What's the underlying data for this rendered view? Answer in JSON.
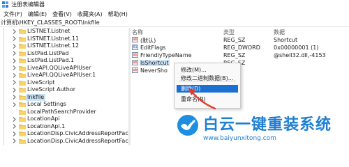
{
  "window": {
    "title": "注册表编辑器"
  },
  "menu": [
    "文件(F)",
    "编辑(E)",
    "查看(V)",
    "收藏夹(A)",
    "帮助(H)"
  ],
  "address": "计算机\\HKEY_CLASSES_ROOT\\lnkfile",
  "tree": {
    "items": [
      {
        "label": "LISTNET.Listnet",
        "expandable": true,
        "selected": false
      },
      {
        "label": "LISTNET.Listnet.11",
        "expandable": true,
        "selected": false
      },
      {
        "label": "LISTNET.Listnet.12",
        "expandable": true,
        "selected": false
      },
      {
        "label": "ListPad.ListPad",
        "expandable": true,
        "selected": false
      },
      {
        "label": "ListPad.ListPad.1",
        "expandable": true,
        "selected": false
      },
      {
        "label": "LiveAPI.QQLiveAPIUser",
        "expandable": true,
        "selected": false
      },
      {
        "label": "LiveAPI.QQLiveAPIUser.1",
        "expandable": true,
        "selected": false
      },
      {
        "label": "LiveScript",
        "expandable": true,
        "selected": false
      },
      {
        "label": "LiveScript Author",
        "expandable": true,
        "selected": false
      },
      {
        "label": "lnkfile",
        "expandable": true,
        "selected": true
      },
      {
        "label": "Local Settings",
        "expandable": true,
        "selected": false
      },
      {
        "label": "LocalPathSearchProvider",
        "expandable": false,
        "selected": false
      },
      {
        "label": "LocationApi",
        "expandable": true,
        "selected": false
      },
      {
        "label": "LocationApi.1",
        "expandable": true,
        "selected": false
      },
      {
        "label": "LocationDisp.CivicAddressReportFactor",
        "expandable": true,
        "selected": false
      },
      {
        "label": "LocationDisp.CivicAddressReportFactor",
        "expandable": true,
        "selected": false
      }
    ]
  },
  "list": {
    "headers": {
      "name": "名称",
      "type": "类型",
      "data": "数据"
    },
    "rows": [
      {
        "name": "(默认)",
        "type": "REG_SZ",
        "data": "Shortcut",
        "icon": "ab",
        "selected": false
      },
      {
        "name": "EditFlags",
        "type": "REG_DWORD",
        "data": "0x00000001 (1)",
        "icon": "num",
        "selected": false
      },
      {
        "name": "FriendlyTypeName",
        "type": "REG_SZ",
        "data": "@shell32.dll,-4153",
        "icon": "ab",
        "selected": false
      },
      {
        "name": "IsShortcut",
        "type": "REG_SZ",
        "data": "",
        "icon": "ab",
        "selected": true
      },
      {
        "name": "NeverSho",
        "type": "",
        "data": "",
        "icon": "ab",
        "selected": false
      }
    ]
  },
  "context_menu": {
    "items": [
      {
        "label": "修改(M)...",
        "hover": false
      },
      {
        "label": "修改二进制数据(B)...",
        "hover": false
      },
      {
        "label": "删除(D)",
        "hover": true
      },
      {
        "label": "重命名(R)",
        "hover": false
      }
    ]
  },
  "watermark": {
    "title": "白云一键重装系统",
    "url": "www.baiyunxitong.com"
  },
  "colors": {
    "accent": "#1c70d2",
    "selection": "#cce4f7",
    "watermark": "#1e7fd1",
    "arrow": "#e23b2e",
    "folder": "#f0c24b"
  }
}
